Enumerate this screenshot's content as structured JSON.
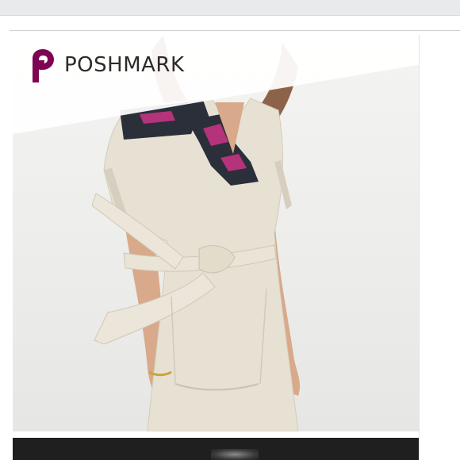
{
  "app": {
    "brand_name": "POSHMARK"
  },
  "colors": {
    "brand": "#7f0353",
    "fabric": "#e6e1d3",
    "embroidery": "#2b2f3a",
    "embroidery_accent": "#b5337a",
    "hair": "#7a4a2c",
    "skin": "#d8a98a"
  },
  "icons": {
    "logo": "poshmark-p-icon"
  },
  "listing": {
    "image_subject": "product-photo"
  }
}
